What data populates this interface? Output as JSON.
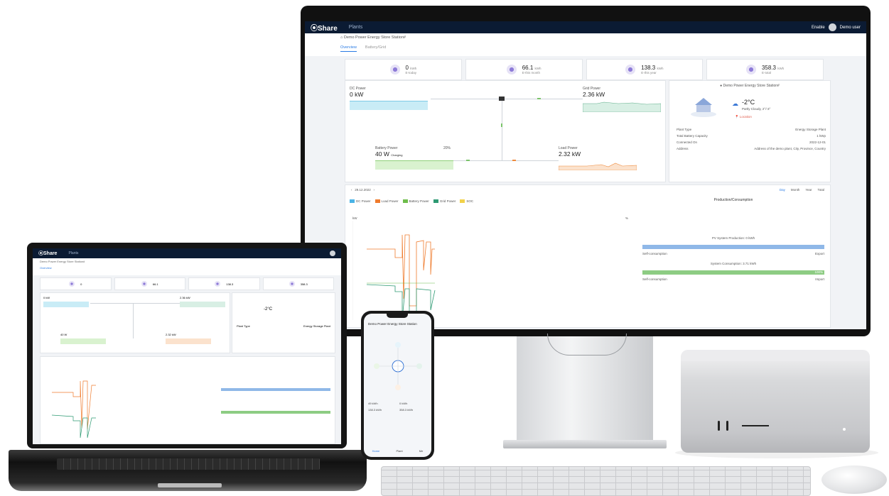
{
  "app": {
    "brand": "Share",
    "nav": "Plants",
    "user_menu": "Enable",
    "user_name": "Demo user",
    "station_name": "Demo Power Energy Store Station#",
    "tabs": [
      "Overview",
      "Battery/Grid"
    ]
  },
  "kpis": [
    {
      "value": "0",
      "unit": "kWh",
      "label": "E-today"
    },
    {
      "value": "66.1",
      "unit": "kWh",
      "label": "E-this month"
    },
    {
      "value": "138.3",
      "unit": "kWh",
      "label": "E-this year"
    },
    {
      "value": "358.3",
      "unit": "kWh",
      "label": "E-total"
    }
  ],
  "flow": {
    "pv_label": "DC Power",
    "pv_value": "0 kW",
    "grid_label": "Grid Power",
    "grid_value": "2.36 kW",
    "battery_label": "Battery Power",
    "battery_value": "40 W",
    "battery_sub": "Charging",
    "battery_soc": "20%",
    "load_label": "Load Power",
    "load_value": "2.32 kW"
  },
  "info": {
    "title": "Demo Power Energy Store Station#",
    "temperature": "-2°C",
    "weather": "Partly Cloudy, 2°/-3°",
    "location": "Location",
    "rows": [
      {
        "k": "Plant Type",
        "v": "Energy Storage Plant"
      },
      {
        "k": "Total Battery Capacity",
        "v": "1 kWp"
      },
      {
        "k": "Connected On",
        "v": "2022-12-01"
      },
      {
        "k": "Address",
        "v": "Address of the demo plant, City, Province, Country"
      }
    ]
  },
  "chart": {
    "date_nav": "29.12.2022",
    "range_tabs": [
      "Day",
      "Month",
      "Year",
      "Total"
    ],
    "legend": [
      {
        "name": "DC Power",
        "color": "#4bb4e6"
      },
      {
        "name": "Load Power",
        "color": "#ef7b2d"
      },
      {
        "name": "Battery Power",
        "color": "#6ebd4b"
      },
      {
        "name": "Grid Power",
        "color": "#2e9a73"
      },
      {
        "name": "SOC",
        "color": "#f2d24a"
      }
    ],
    "y_left": "kW",
    "y_right": "%",
    "pc_title": "Production/Consumption",
    "production": "PV System Production: 0 kWh",
    "self_consumption_1": "Self-consumption",
    "export": "Export",
    "consumption": "System Consumption: 3.71 kWh",
    "self_consumption_2": "Self-consumption",
    "import": "Import",
    "pct_100": "100%"
  },
  "phone": {
    "title": "Demo Power Energy Store Station",
    "kpi1": "49 kWh",
    "kpi2": "0 kWh",
    "kpi3": "138.3 kWh",
    "kpi4": "358.3 kWh",
    "tabs": [
      "Home",
      "Plant",
      "Me"
    ]
  },
  "chart_data": {
    "type": "line",
    "title": "",
    "xlabel": "",
    "ylabel": "kW",
    "series": [
      {
        "name": "DC Power",
        "values": []
      },
      {
        "name": "Load Power",
        "values": []
      },
      {
        "name": "Battery Power",
        "values": []
      },
      {
        "name": "Grid Power",
        "values": []
      },
      {
        "name": "SOC",
        "values": []
      }
    ]
  }
}
